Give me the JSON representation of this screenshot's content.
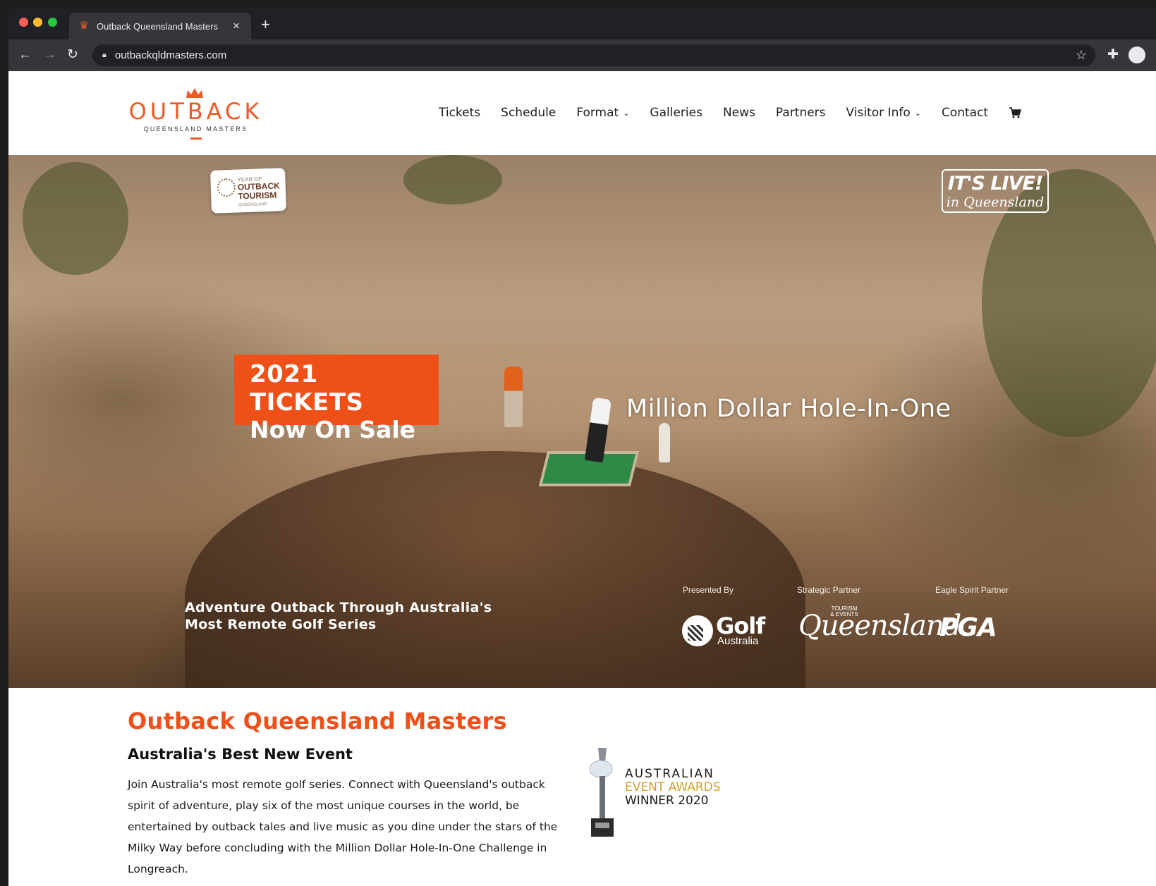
{
  "browser": {
    "tab_title": "Outback Queensland Masters",
    "url": "outbackqldmasters.com"
  },
  "site": {
    "logo_word": "OUTBACK",
    "logo_sub": "QUEENSLAND MASTERS",
    "brand_color": "#ee5018",
    "nav": [
      {
        "label": "Tickets"
      },
      {
        "label": "Schedule"
      },
      {
        "label": "Format",
        "dropdown": true
      },
      {
        "label": "Galleries"
      },
      {
        "label": "News"
      },
      {
        "label": "Partners"
      },
      {
        "label": "Visitor Info",
        "dropdown": true
      },
      {
        "label": "Contact"
      }
    ]
  },
  "hero": {
    "yot_badge": {
      "l1": "YEAR OF",
      "l2": "OUTBACK",
      "l3": "TOURISM",
      "l4": "QUEENSLAND"
    },
    "live_badge": {
      "top": "IT'S LIVE!",
      "bottom": "in Queensland"
    },
    "cta": {
      "line1": "2021 TICKETS",
      "line2": "Now On Sale"
    },
    "headline": "Million Dollar Hole-In-One",
    "tagline": {
      "line1": "Adventure Outback Through Australia's",
      "line2": "Most Remote Golf Series"
    },
    "partners": [
      {
        "label": "Presented By",
        "logo_main": "Golf",
        "logo_sub": "Australia"
      },
      {
        "label": "Strategic Partner",
        "logo_main": "Queensland",
        "logo_sub": "TOURISM & EVENTS"
      },
      {
        "label": "Eagle Spirit Partner",
        "logo_main": "PGA"
      }
    ]
  },
  "content": {
    "title": "Outback Queensland Masters",
    "subtitle": "Australia's Best New Event",
    "body": "Join Australia's most remote golf series. Connect with Queensland's outback spirit of adventure, play six of the most unique courses in the world, be entertained by outback tales and live music as you dine under the stars of the Milky Way before concluding with the Million Dollar Hole-In-One Challenge in Longreach.",
    "award": {
      "line1": "AUSTRALIAN",
      "line2": "EVENT AWARDS",
      "line3": "WINNER 2020"
    }
  }
}
